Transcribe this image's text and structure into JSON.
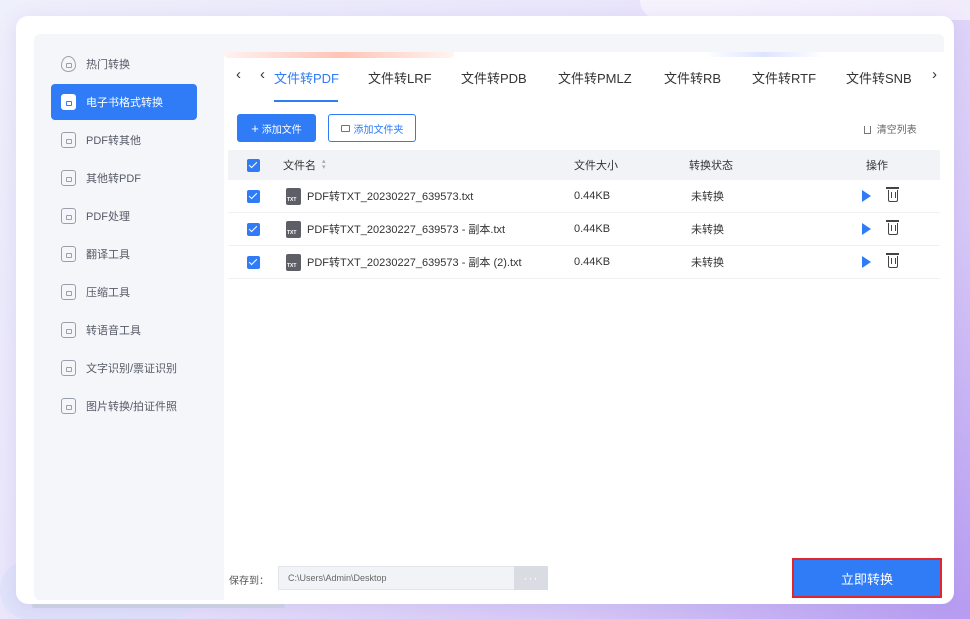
{
  "sidebar": {
    "items": [
      {
        "label": "热门转换",
        "icon": "fire-icon"
      },
      {
        "label": "电子书格式转换",
        "icon": "ebook-icon"
      },
      {
        "label": "PDF转其他",
        "icon": "pdf-export-icon"
      },
      {
        "label": "其他转PDF",
        "icon": "pdf-import-icon"
      },
      {
        "label": "PDF处理",
        "icon": "pdf-edit-icon"
      },
      {
        "label": "翻译工具",
        "icon": "translate-icon"
      },
      {
        "label": "压缩工具",
        "icon": "compress-icon"
      },
      {
        "label": "转语音工具",
        "icon": "audio-icon"
      },
      {
        "label": "文字识别/票证识别",
        "icon": "ocr-icon"
      },
      {
        "label": "图片转换/拍证件照",
        "icon": "image-icon"
      }
    ],
    "active_index": 1
  },
  "tabs": {
    "items": [
      {
        "label": "文件转PDF"
      },
      {
        "label": "文件转LRF"
      },
      {
        "label": "文件转PDB"
      },
      {
        "label": "文件转PMLZ"
      },
      {
        "label": "文件转RB"
      },
      {
        "label": "文件转RTF"
      },
      {
        "label": "文件转SNB"
      }
    ],
    "active_index": 0,
    "prev_arrow": "‹",
    "next_arrow": "›"
  },
  "toolbar": {
    "add_file": "添加文件",
    "add_folder": "添加文件夹",
    "clear_list": "清空列表"
  },
  "table": {
    "headers": {
      "name": "文件名",
      "size": "文件大小",
      "status": "转换状态",
      "action": "操作"
    },
    "rows": [
      {
        "name": "PDF转TXT_20230227_639573.txt",
        "size": "0.44KB",
        "status": "未转换",
        "checked": true
      },
      {
        "name": "PDF转TXT_20230227_639573 - 副本.txt",
        "size": "0.44KB",
        "status": "未转换",
        "checked": true
      },
      {
        "name": "PDF转TXT_20230227_639573 - 副本 (2).txt",
        "size": "0.44KB",
        "status": "未转换",
        "checked": true
      }
    ],
    "file_type_badge": "TXT"
  },
  "footer": {
    "save_label": "保存到：",
    "save_path": "C:\\Users\\Admin\\Desktop",
    "browse_label": "···",
    "convert_label": "立即转换"
  },
  "colors": {
    "accent": "#2f7cf6",
    "highlight_border": "#e0262c"
  }
}
